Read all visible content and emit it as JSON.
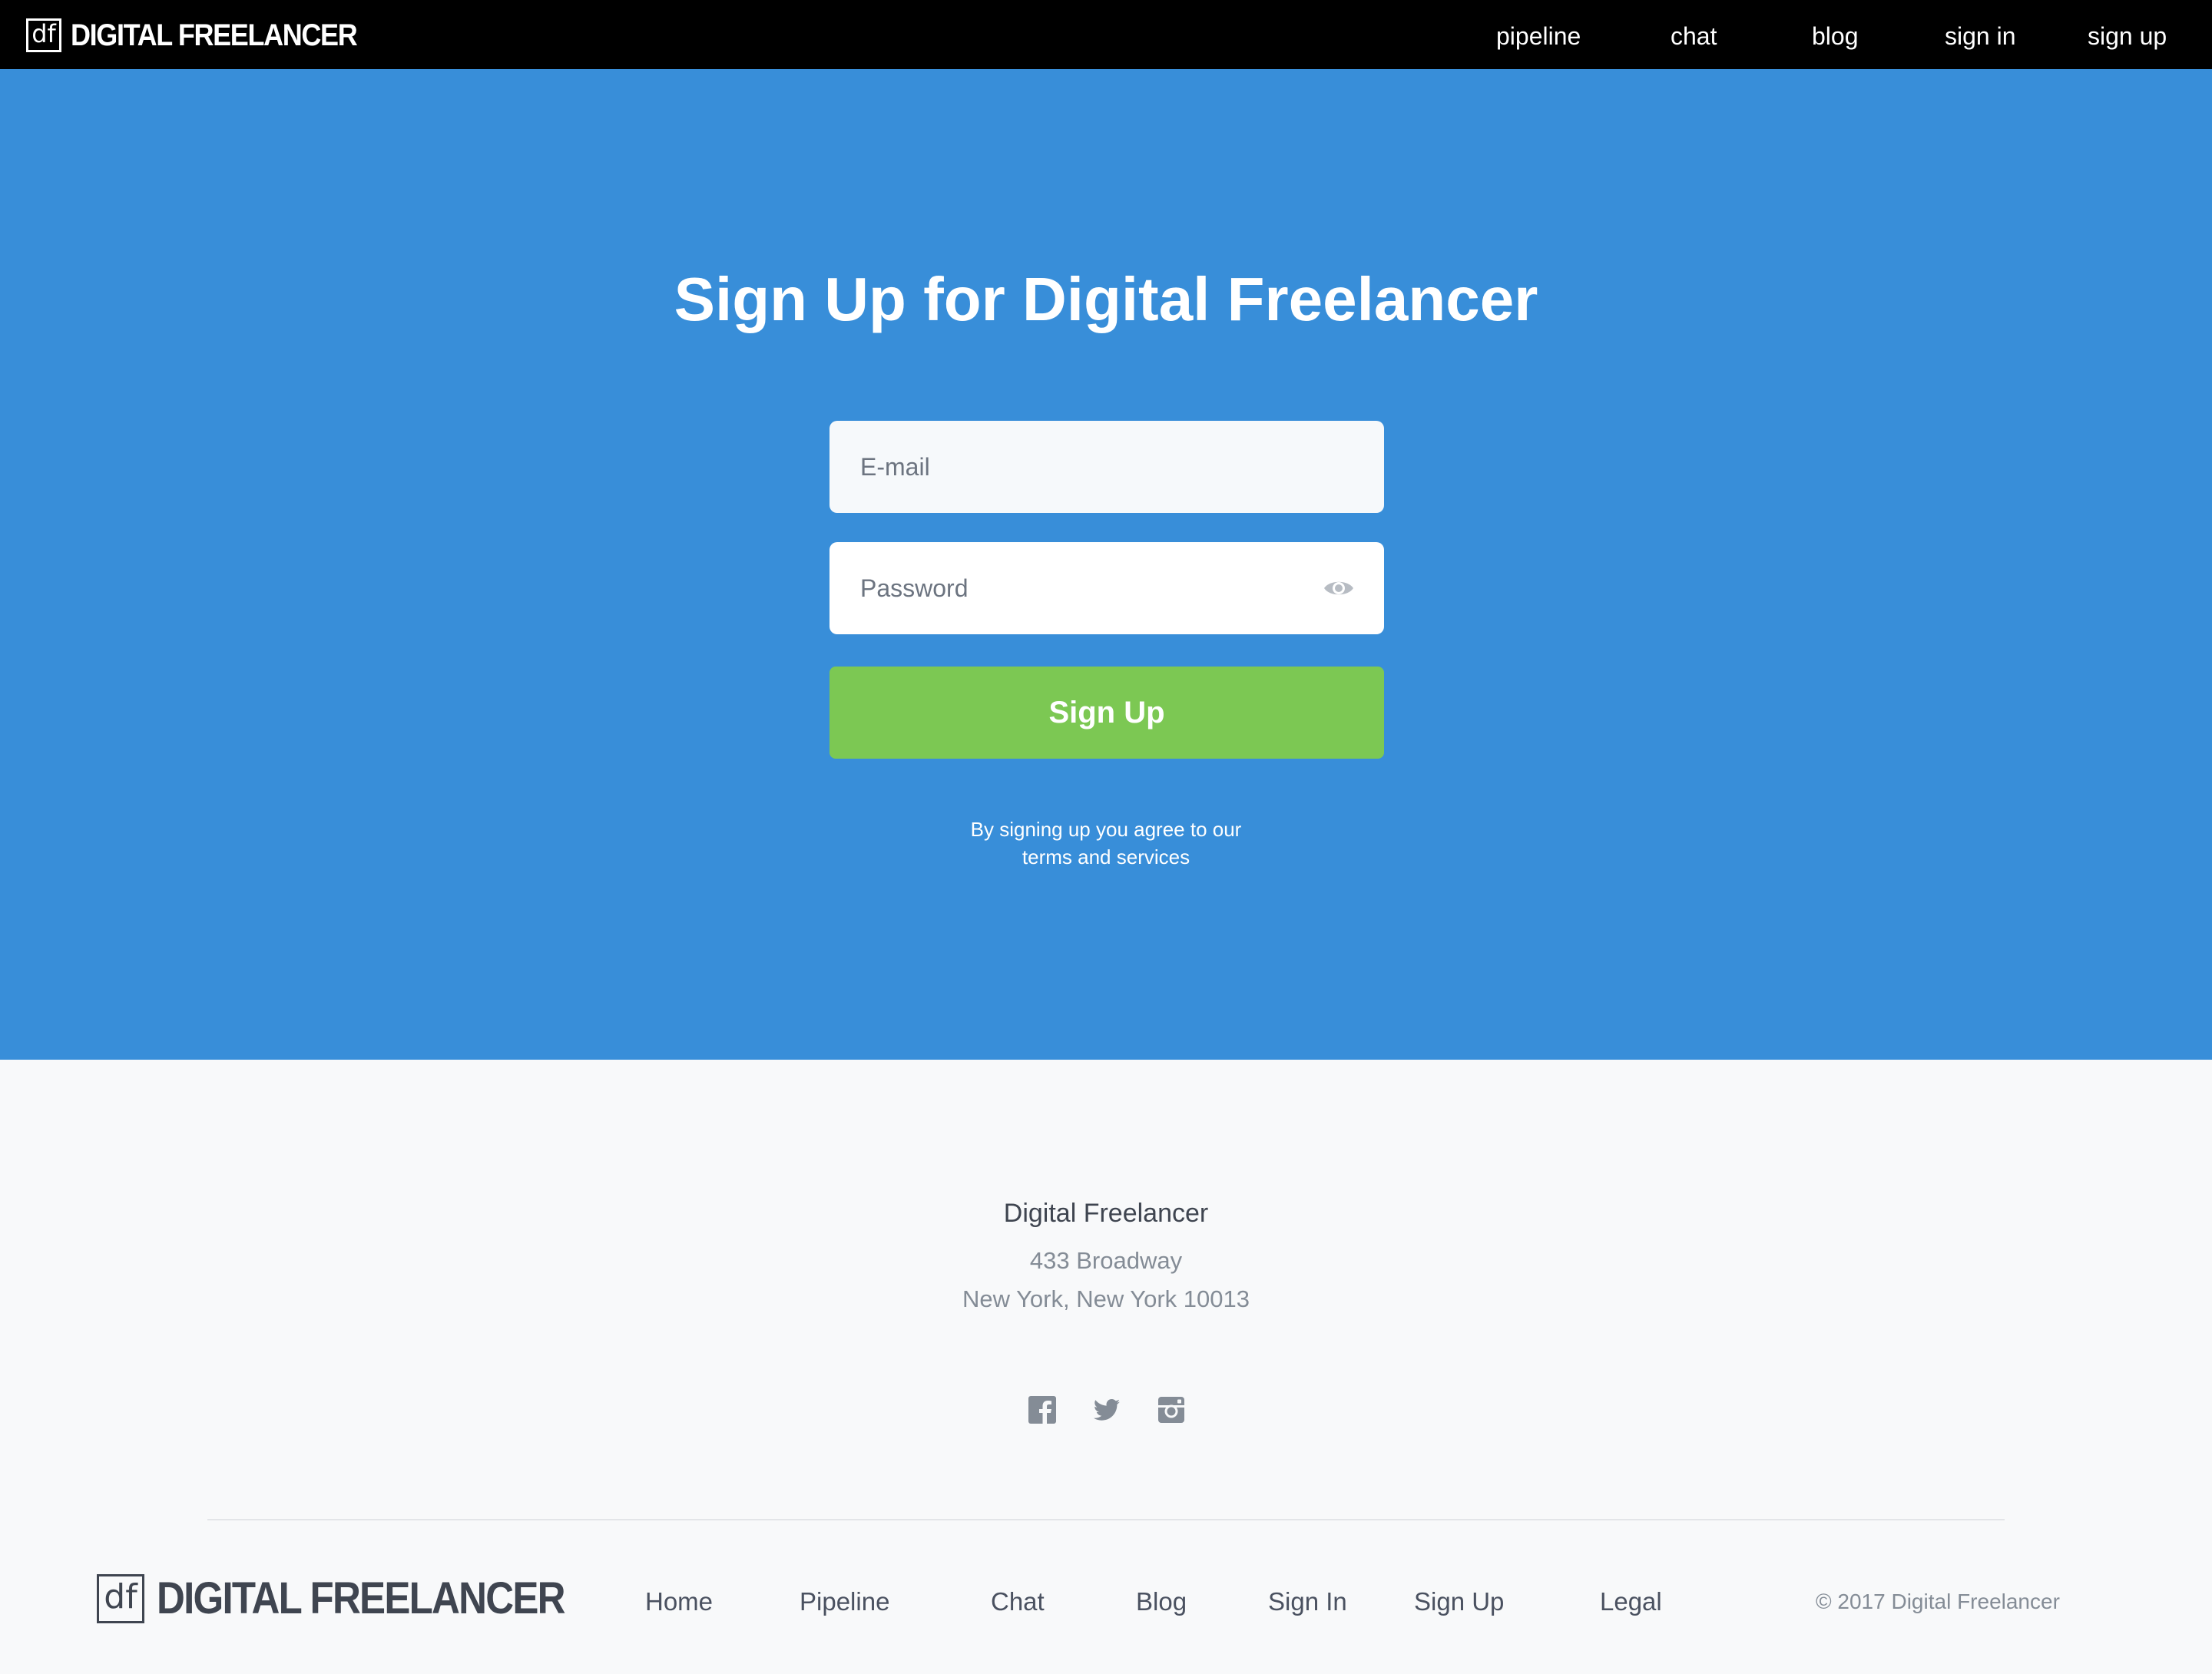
{
  "brand": {
    "logo_mark": "df",
    "name": "DIGITAL FREELANCER"
  },
  "topnav": {
    "items": [
      {
        "label": "pipeline"
      },
      {
        "label": "chat"
      },
      {
        "label": "blog"
      },
      {
        "label": "sign in"
      },
      {
        "label": "sign up"
      }
    ]
  },
  "hero": {
    "title": "Sign Up for Digital Freelancer",
    "email_placeholder": "E-mail",
    "password_placeholder": "Password",
    "password_toggle_icon": "eye-icon",
    "submit_label": "Sign Up",
    "terms_line1": "By signing up you agree to our",
    "terms_line2": "terms and services"
  },
  "footer": {
    "company_name": "Digital Freelancer",
    "address_line1": "433 Broadway",
    "address_line2": "New York, New York 10013",
    "social_icons": [
      "facebook-icon",
      "twitter-icon",
      "instagram-icon"
    ],
    "links": [
      {
        "label": "Home"
      },
      {
        "label": "Pipeline"
      },
      {
        "label": "Chat"
      },
      {
        "label": "Blog"
      },
      {
        "label": "Sign In"
      },
      {
        "label": "Sign Up"
      },
      {
        "label": "Legal"
      }
    ],
    "copyright": "© 2017 Digital Freelancer"
  },
  "colors": {
    "hero_blue": "#388ed9",
    "button_green": "#7cc853",
    "topbar_black": "#000000",
    "footer_bg": "#f8f9fa"
  }
}
